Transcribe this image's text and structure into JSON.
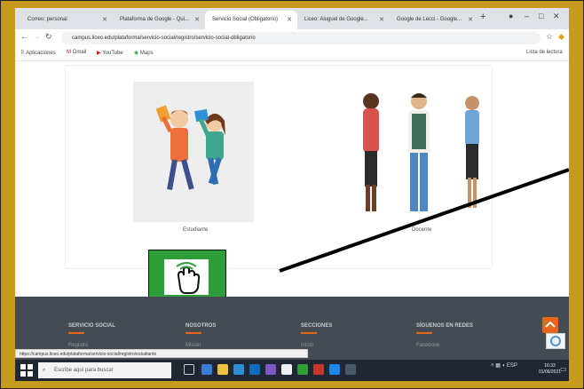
{
  "browser": {
    "tabs": [
      {
        "label": "Correo: personal"
      },
      {
        "label": "Plataforma de Google - Qui..."
      },
      {
        "label": "Servicio Social (Obligatorio)"
      },
      {
        "label": "Liceo: Aluguel de Google..."
      },
      {
        "label": "Google de Lecci - Google..."
      }
    ],
    "new_tab_label": "+",
    "url": "campus.liceo.edu/plataforma/servicio-social/registro/servicio-social-obligatorio",
    "bookmarks": [
      "Aplicaciones",
      "Gmail",
      "YouTube",
      "Maps"
    ],
    "reading_list": "Lista de lectura"
  },
  "page": {
    "cards": [
      {
        "caption": "Estudiante"
      },
      {
        "caption": "Docente"
      }
    ]
  },
  "footer": {
    "columns": [
      {
        "heading": "SERVICIO SOCIAL",
        "link": "Registro"
      },
      {
        "heading": "NOSOTROS",
        "link": "Misión"
      },
      {
        "heading": "SECCIONES",
        "link": "Inicio"
      },
      {
        "heading": "SÍGUENOS EN REDES",
        "link": "Facebook"
      }
    ]
  },
  "status_url": "https://campus.liceo.edu/plataforma/servicio-social/registro/estudiante",
  "taskbar": {
    "search_placeholder": "Escribe aquí para buscar",
    "tray_text": "ESP",
    "time": "16:33",
    "date": "01/06/2021"
  },
  "colors": {
    "frame": "#c69a1e",
    "highlight_box": "#2e9e3b",
    "accent": "#e8641b",
    "footer_bg": "#444b52"
  }
}
